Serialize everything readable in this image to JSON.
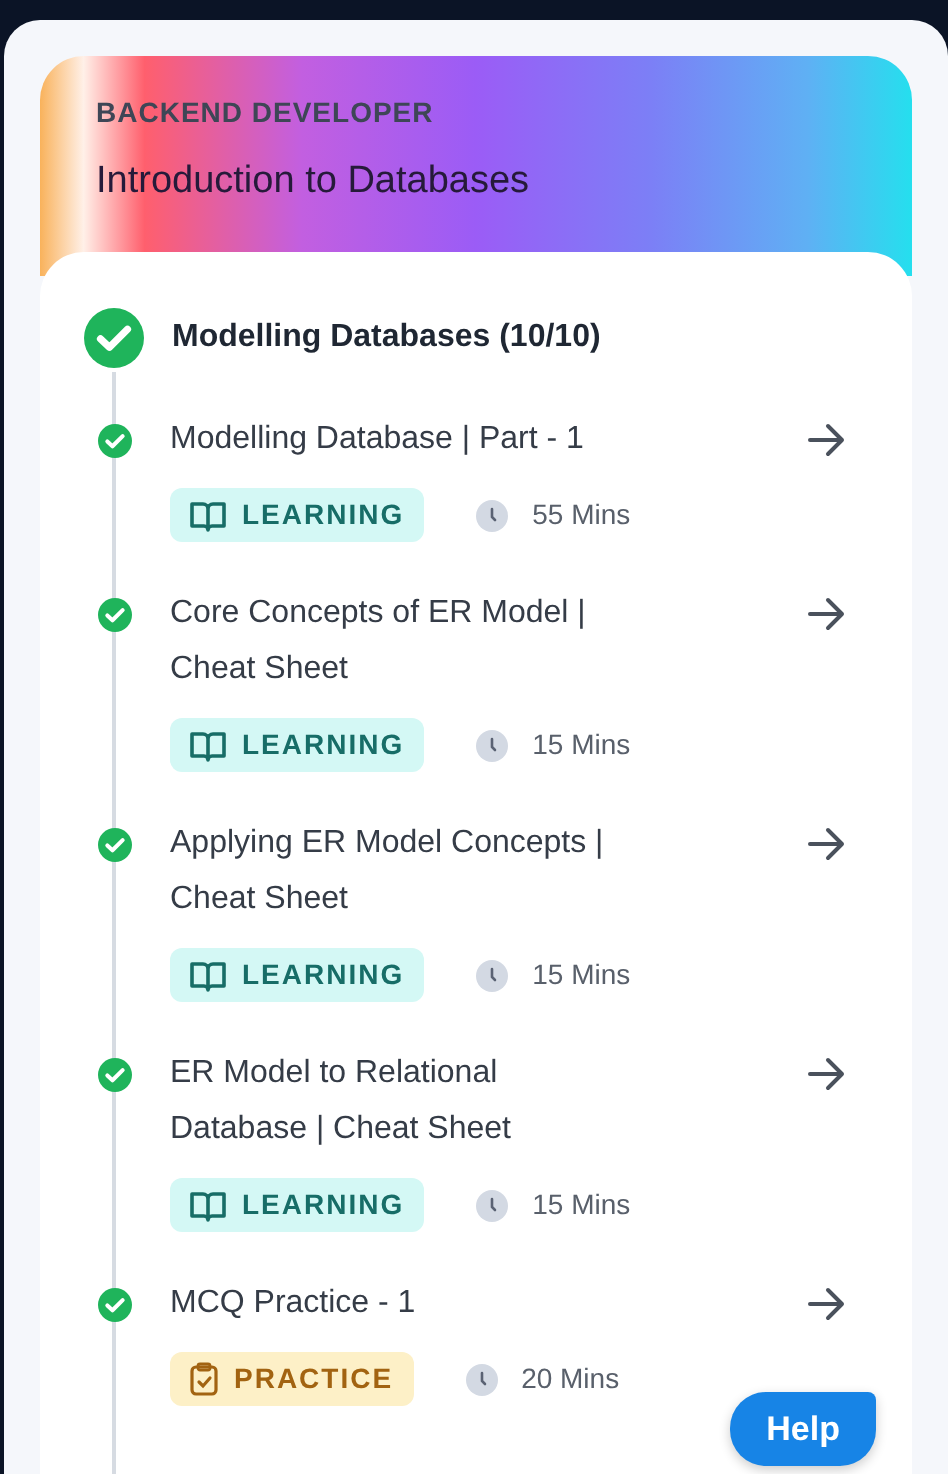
{
  "header": {
    "track": "BACKEND DEVELOPER",
    "course": "Introduction to Databases"
  },
  "module": {
    "title": "Modelling Databases (10/10)",
    "completed": true
  },
  "items": [
    {
      "title": "Modelling Database | Part - 1",
      "kind": "learning",
      "tag": "LEARNING",
      "duration": "55 Mins",
      "completed": true
    },
    {
      "title": "Core Concepts of ER Model | Cheat Sheet",
      "kind": "learning",
      "tag": "LEARNING",
      "duration": "15 Mins",
      "completed": true
    },
    {
      "title": "Applying ER Model Concepts | Cheat Sheet",
      "kind": "learning",
      "tag": "LEARNING",
      "duration": "15 Mins",
      "completed": true
    },
    {
      "title": "ER Model to Relational Database | Cheat Sheet",
      "kind": "learning",
      "tag": "LEARNING",
      "duration": "15 Mins",
      "completed": true
    },
    {
      "title": "MCQ Practice - 1",
      "kind": "practice",
      "tag": "PRACTICE",
      "duration": "20 Mins",
      "completed": true
    }
  ],
  "help_button": "Help"
}
